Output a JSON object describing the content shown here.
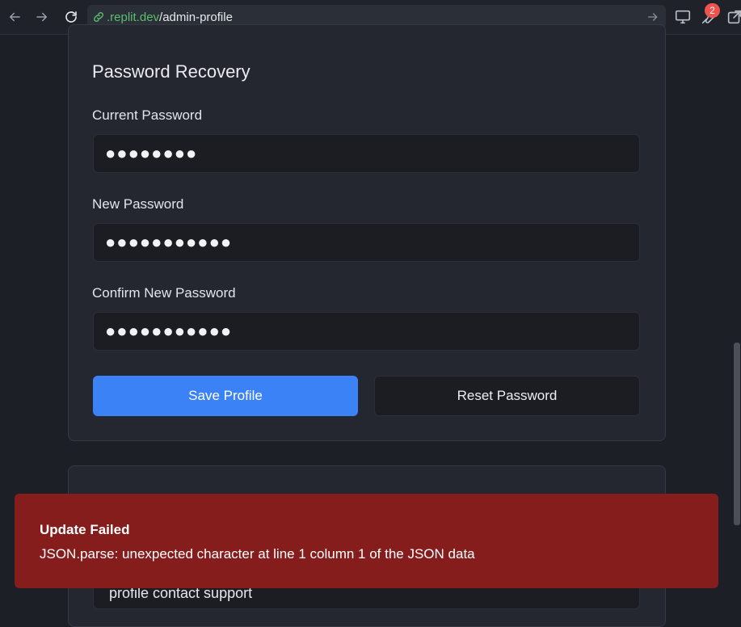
{
  "browser": {
    "url_host": ".replit.dev",
    "url_path": "/admin-profile",
    "notification_count": "2",
    "icons": [
      "back-icon",
      "forward-icon",
      "reload-icon",
      "link-icon",
      "go-arrow-icon",
      "monitor-icon",
      "wrench-icon",
      "external-link-icon"
    ]
  },
  "page": {
    "section_title": "Password Recovery",
    "current_password_label": "Current Password",
    "current_password_value": "●●●●●●●●",
    "new_password_label": "New Password",
    "new_password_value": "●●●●●●●●●●●",
    "confirm_password_label": "Confirm New Password",
    "confirm_password_value": "●●●●●●●●●●●",
    "save_button": "Save Profile",
    "reset_button": "Reset Password",
    "partial_text": "profile contact  support"
  },
  "toast": {
    "title": "Update Failed",
    "message": "JSON.parse: unexpected character at line 1 column 1 of the JSON data"
  },
  "colors": {
    "primary": "#3b82f6",
    "error": "#861d1d",
    "link_green": "#5bbd6f",
    "badge": "#ef5350"
  }
}
